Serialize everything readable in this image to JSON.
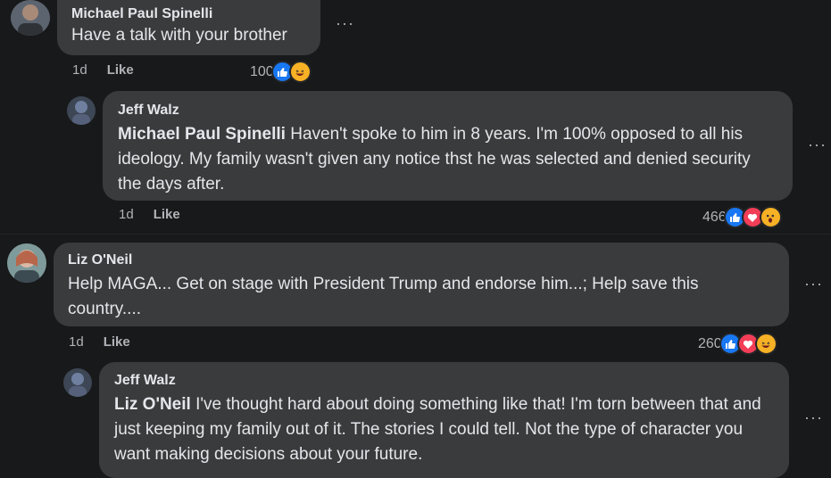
{
  "comments": [
    {
      "author": "Michael Paul Spinelli",
      "text": "Have a talk with your brother",
      "time": "1d",
      "like_label": "Like",
      "reaction_count": "100",
      "reactions": [
        "like-icon",
        "haha-icon"
      ]
    },
    {
      "author": "Jeff Walz",
      "mention": "Michael Paul Spinelli",
      "text": " Haven't spoke to him in 8 years. I'm 100% opposed to all his ideology. My family wasn't given any notice thst he was selected and denied security the days after.",
      "time": "1d",
      "like_label": "Like",
      "reaction_count": "466",
      "reactions": [
        "like-icon",
        "love-icon",
        "wow-icon"
      ]
    },
    {
      "author": "Liz O'Neil",
      "text": "Help MAGA... Get on stage with President Trump and endorse him...; Help save this country....",
      "time": "1d",
      "like_label": "Like",
      "reaction_count": "260",
      "reactions": [
        "like-icon",
        "love-icon",
        "haha-icon"
      ]
    },
    {
      "author": "Jeff Walz",
      "mention": "Liz O'Neil",
      "text": " I've thought hard about doing something like that! I'm torn between that and just keeping my family out of it. The stories I could tell. Not the type of character you want making decisions about your future."
    }
  ],
  "more_label": "···",
  "colors": {
    "like": "#1877f2",
    "love": "#f33e58",
    "haha": "#f7b125",
    "bubble": "#3a3b3c",
    "background": "#18191a"
  }
}
